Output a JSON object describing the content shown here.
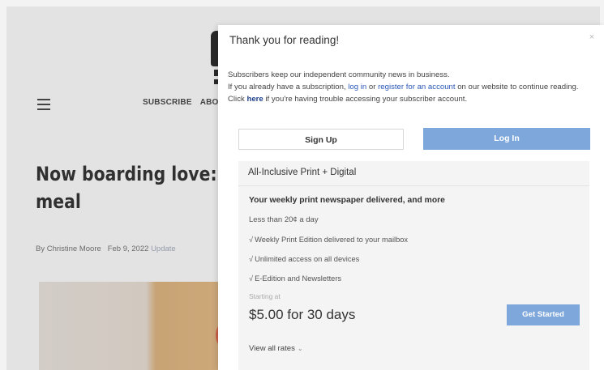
{
  "background": {
    "nav": [
      "SUBSCRIBE",
      "ABOU"
    ],
    "headline": "Now boarding love: meal",
    "byline": {
      "author": "By Christine Moore",
      "date": "Feb 9, 2022",
      "updated": "Update"
    }
  },
  "modal": {
    "title": "Thank you for reading!",
    "close_icon": "×",
    "text": {
      "line1": "Subscribers keep our independent community news in business.",
      "line2_pre": "If you already have a subscription, ",
      "login_link": "log in",
      "or": " or ",
      "register_link": "register for an account",
      "line2_post": " on our website to continue reading.",
      "line3_pre": "Click ",
      "here_link": "here",
      "line3_post": " if you're having trouble accessing your subscriber account."
    },
    "buttons": {
      "signup": "Sign Up",
      "login": "Log In"
    },
    "plan": {
      "name": "All-Inclusive Print + Digital",
      "subtitle": "Your weekly print newspaper delivered, and more",
      "per_day": "Less than 20¢ a day",
      "features": [
        "Weekly Print Edition delivered to your mailbox",
        "Unlimited access on all devices",
        "E-Edition and Newsletters"
      ],
      "starting_at": "Starting at",
      "price": "$5.00 for 30 days",
      "cta": "Get Started",
      "view_all": "View all rates"
    }
  },
  "colors": {
    "accent": "#7ea7dc",
    "link": "#2b58b8"
  }
}
